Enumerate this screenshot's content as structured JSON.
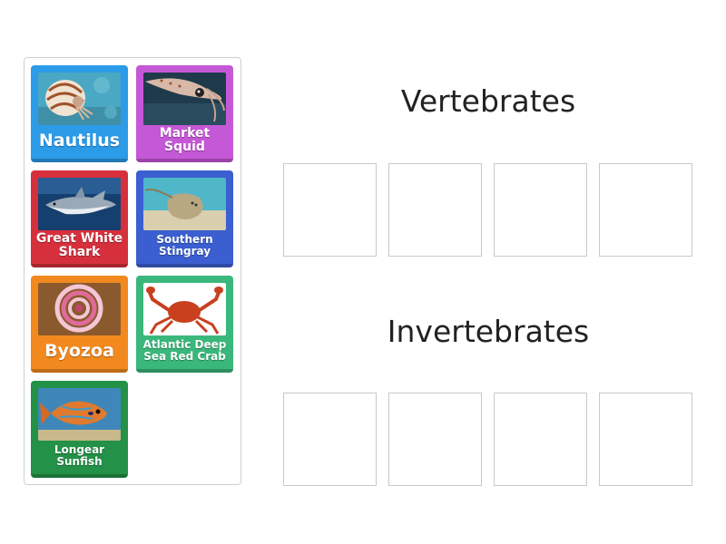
{
  "tray": {
    "cards": [
      {
        "label": "Nautilus",
        "color": "#2c9be8",
        "image": "nautilus-image"
      },
      {
        "label": "Market Squid",
        "color": "#c558d6",
        "image": "squid-image"
      },
      {
        "label": "Great White Shark",
        "color": "#d6303d",
        "image": "shark-image"
      },
      {
        "label": "Southern Stingray",
        "color": "#3b5fd0",
        "image": "stingray-image"
      },
      {
        "label": "Byozoa",
        "color": "#f2891e",
        "image": "bryozoa-image"
      },
      {
        "label": "Atlantic Deep Sea Red Crab",
        "color": "#3ab87b",
        "image": "crab-image"
      },
      {
        "label": "Longear Sunfish",
        "color": "#239147",
        "image": "sunfish-image"
      }
    ]
  },
  "groups": [
    {
      "heading": "Vertebrates"
    },
    {
      "heading": "Invertebrates"
    }
  ]
}
